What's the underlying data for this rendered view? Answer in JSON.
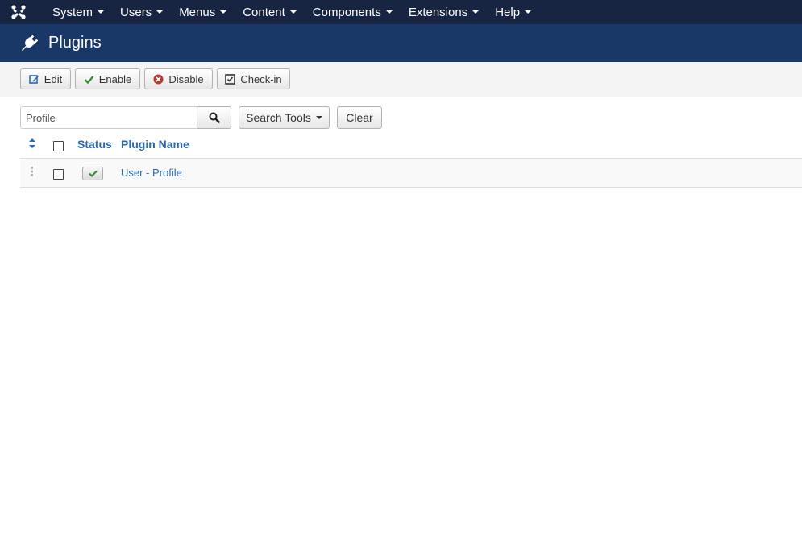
{
  "topnav": {
    "logo_icon": "joomla-logo-icon",
    "items": [
      {
        "label": "System"
      },
      {
        "label": "Users"
      },
      {
        "label": "Menus"
      },
      {
        "label": "Content"
      },
      {
        "label": "Components"
      },
      {
        "label": "Extensions"
      },
      {
        "label": "Help"
      }
    ]
  },
  "header": {
    "title": "Plugins",
    "icon": "plug-icon"
  },
  "toolbar": {
    "edit_label": "Edit",
    "enable_label": "Enable",
    "disable_label": "Disable",
    "checkin_label": "Check-in"
  },
  "search": {
    "value": "Profile",
    "search_tools_label": "Search Tools",
    "clear_label": "Clear"
  },
  "table": {
    "columns": {
      "status": "Status",
      "plugin_name": "Plugin Name"
    },
    "rows": [
      {
        "status": "enabled",
        "name": "User - Profile"
      }
    ]
  },
  "colors": {
    "topnav_bg": "#172542",
    "header_bg": "#1a3867",
    "link": "#2a69b8",
    "enabled_green": "#3a8a3a",
    "disable_red": "#bd362f"
  }
}
